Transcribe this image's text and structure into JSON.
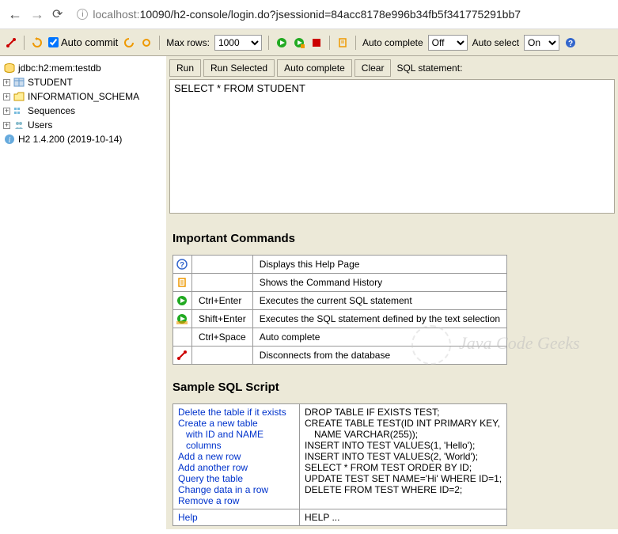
{
  "browser": {
    "url_prefix": "localhost:",
    "url_main": "10090/h2-console/login.do?jsessionid=84acc8178e996b34fb5f341775291bb7"
  },
  "toolbar": {
    "auto_commit": "Auto commit",
    "max_rows": "Max rows:",
    "max_rows_value": "1000",
    "auto_complete": "Auto complete",
    "auto_complete_value": "Off",
    "auto_select": "Auto select",
    "auto_select_value": "On"
  },
  "tree": {
    "db": "jdbc:h2:mem:testdb",
    "items": [
      "STUDENT",
      "INFORMATION_SCHEMA",
      "Sequences",
      "Users"
    ],
    "version": "H2 1.4.200 (2019-10-14)"
  },
  "sql": {
    "run": "Run",
    "run_selected": "Run Selected",
    "auto_complete": "Auto complete",
    "clear": "Clear",
    "label": "SQL statement:",
    "value": "SELECT * FROM STUDENT "
  },
  "important": {
    "title": "Important Commands",
    "rows": [
      {
        "key": "",
        "desc": "Displays this Help Page"
      },
      {
        "key": "",
        "desc": "Shows the Command History"
      },
      {
        "key": "Ctrl+Enter",
        "desc": "Executes the current SQL statement"
      },
      {
        "key": "Shift+Enter",
        "desc": "Executes the SQL statement defined by the text selection"
      },
      {
        "key": "Ctrl+Space",
        "desc": "Auto complete"
      },
      {
        "key": "",
        "desc": "Disconnects from the database"
      }
    ]
  },
  "sample": {
    "title": "Sample SQL Script",
    "rows": [
      {
        "desc": [
          "Delete the table if it exists"
        ],
        "sql": [
          "DROP TABLE IF EXISTS TEST;"
        ]
      },
      {
        "desc": [
          "Create a new table",
          "with ID and NAME columns"
        ],
        "sql": [
          "CREATE TABLE TEST(ID INT PRIMARY KEY,",
          "NAME VARCHAR(255));"
        ],
        "indent": [
          false,
          true
        ]
      },
      {
        "desc": [
          "Add a new row"
        ],
        "sql": [
          "INSERT INTO TEST VALUES(1, 'Hello');"
        ]
      },
      {
        "desc": [
          "Add another row"
        ],
        "sql": [
          "INSERT INTO TEST VALUES(2, 'World');"
        ]
      },
      {
        "desc": [
          "Query the table"
        ],
        "sql": [
          "SELECT * FROM TEST ORDER BY ID;"
        ]
      },
      {
        "desc": [
          "Change data in a row"
        ],
        "sql": [
          "UPDATE TEST SET NAME='Hi' WHERE ID=1;"
        ]
      },
      {
        "desc": [
          "Remove a row"
        ],
        "sql": [
          "DELETE FROM TEST WHERE ID=2;"
        ]
      }
    ],
    "help_desc": "Help",
    "help_sql": "HELP ..."
  },
  "watermark": "Java Code Geeks"
}
